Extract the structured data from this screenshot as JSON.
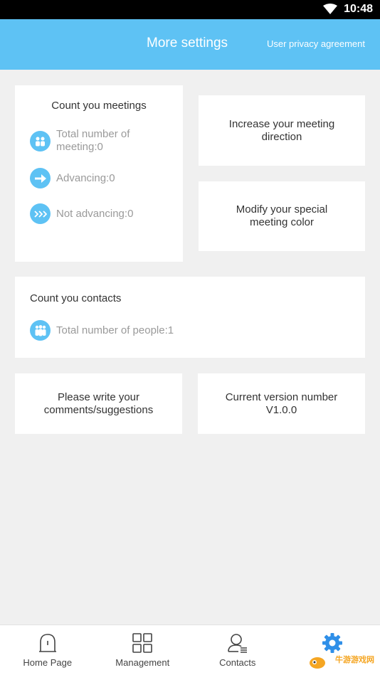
{
  "status_bar": {
    "time": "10:48"
  },
  "header": {
    "title": "More settings",
    "privacy_link": "User privacy agreement"
  },
  "meetings_card": {
    "title": "Count you meetings",
    "total": "Total number of\nmeeting:0",
    "advancing": "Advancing:0",
    "not_advancing": "Not advancing:0"
  },
  "direction_card": {
    "label": "Increase your meeting\ndirection"
  },
  "color_card": {
    "label": "Modify your special\nmeeting color"
  },
  "contacts_card": {
    "title": "Count you contacts",
    "total": "Total number of people:1"
  },
  "feedback_card": {
    "label": "Please write your\ncomments/suggestions"
  },
  "version_card": {
    "label": "Current version number\nV1.0.0"
  },
  "tab_bar": {
    "items": [
      {
        "label": "Home Page",
        "icon": "home-icon"
      },
      {
        "label": "Management",
        "icon": "grid-icon"
      },
      {
        "label": "Contacts",
        "icon": "contacts-icon"
      },
      {
        "label": "",
        "icon": "gear-icon",
        "active": true
      }
    ]
  },
  "watermark": "牛游游戏网",
  "colors": {
    "accent": "#5ec2f4",
    "background": "#f0f0f0"
  }
}
